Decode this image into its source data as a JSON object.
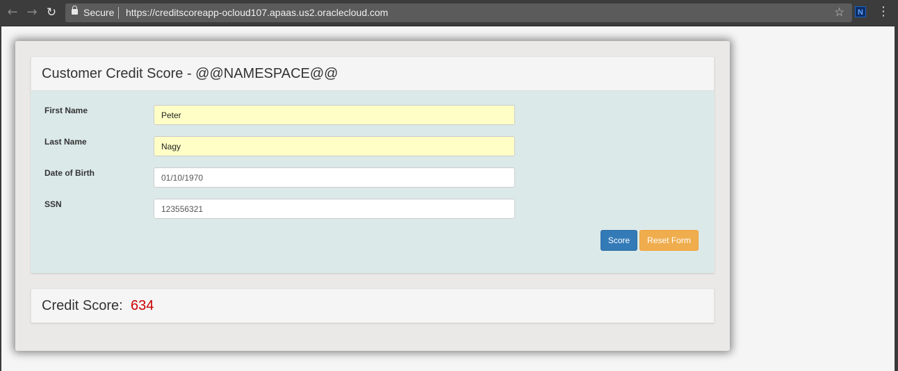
{
  "browser": {
    "secure_label": "Secure",
    "url": "https://creditscoreapp-ocloud107.apaas.us2.oraclecloud.com",
    "extension_letter": "N"
  },
  "form": {
    "title": "Customer Credit Score - @@NAMESPACE@@",
    "fields": [
      {
        "label": "First Name",
        "value": "Peter"
      },
      {
        "label": "Last Name",
        "value": "Nagy"
      },
      {
        "label": "Date of Birth",
        "value": "01/10/1970"
      },
      {
        "label": "SSN",
        "value": "123556321"
      }
    ],
    "score_button": "Score",
    "reset_button": "Reset Form"
  },
  "result": {
    "label": "Credit Score:",
    "value": "634"
  },
  "colors": {
    "primary": "#337ab7",
    "warning": "#f0ad4e",
    "score_value": "#cc0000",
    "autofill": "#fefec6"
  }
}
